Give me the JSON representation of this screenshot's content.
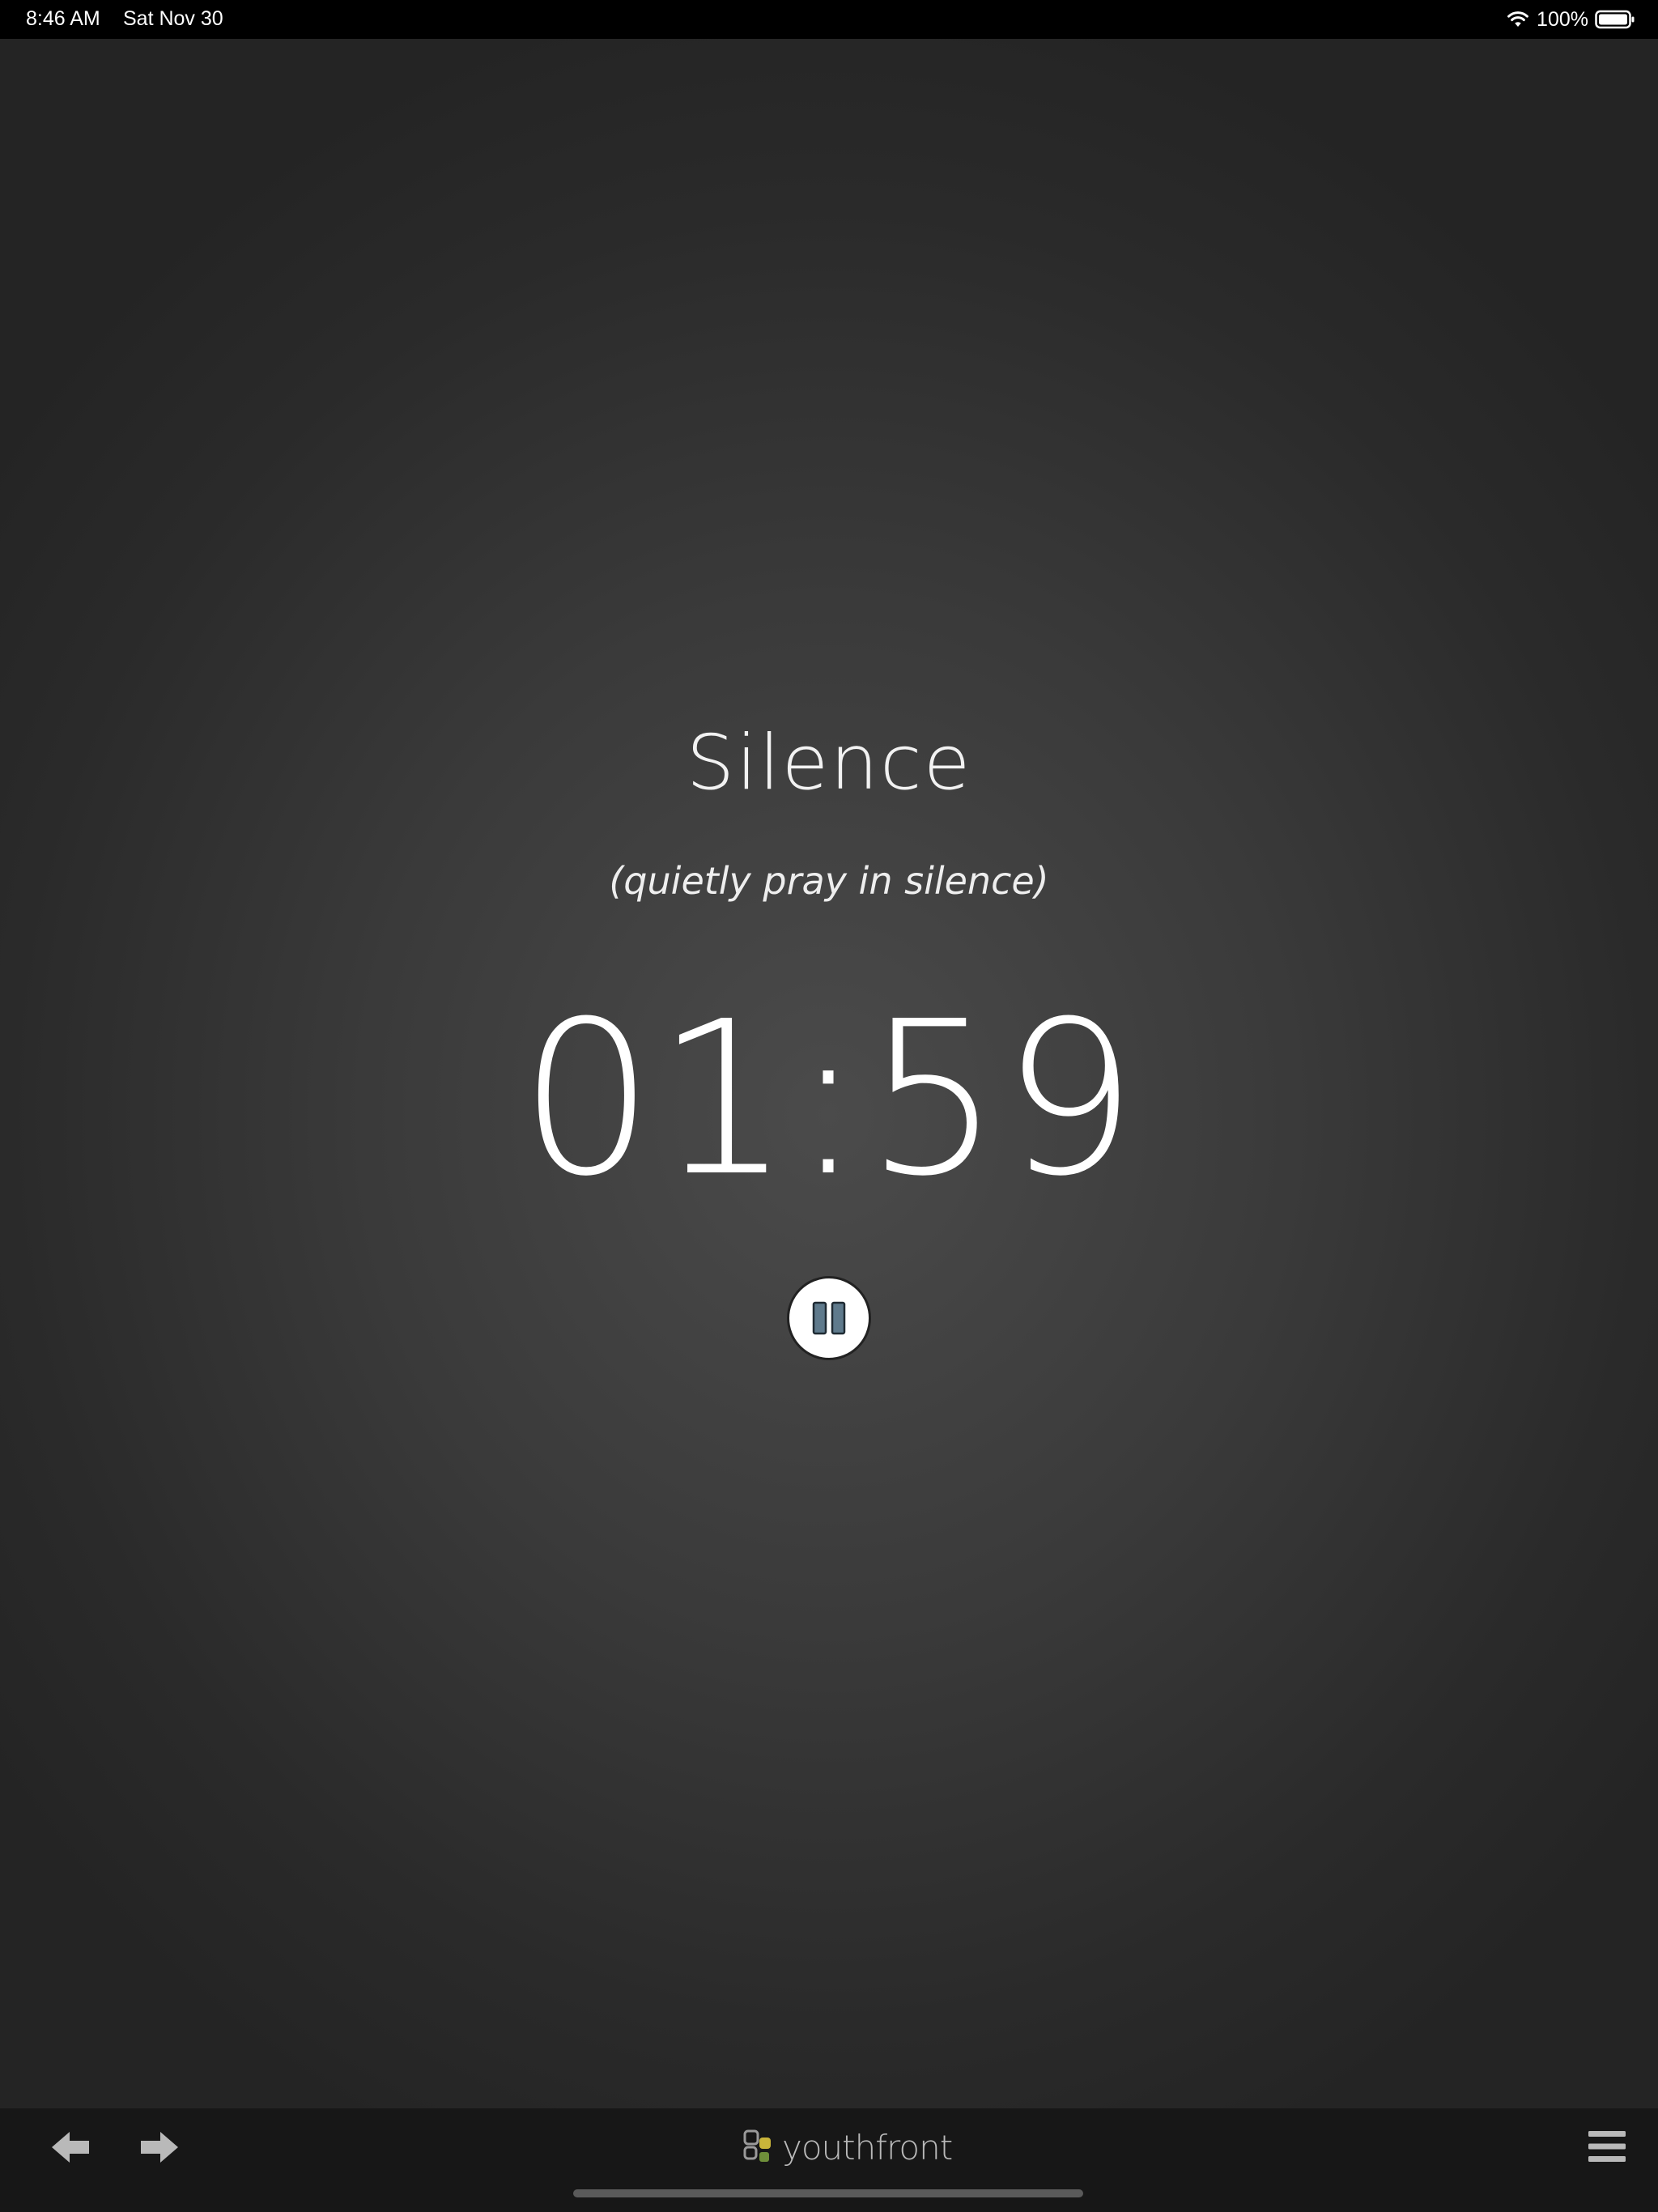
{
  "status_bar": {
    "time": "8:46 AM",
    "date": "Sat Nov 30",
    "battery": "100%",
    "icons": [
      "wifi-icon",
      "battery-icon"
    ]
  },
  "main": {
    "title": "Silence",
    "subtitle": "(quietly pray in silence)",
    "timer": "01:59",
    "pause_icon": "pause-icon"
  },
  "toolbar": {
    "back_icon": "arrow-left-icon",
    "forward_icon": "arrow-right-icon",
    "brand_name": "youthfront",
    "menu_icon": "hamburger-menu-icon"
  },
  "colors": {
    "background_center": "#4b4b4b",
    "background_edge": "#242424",
    "toolbar": "#171717",
    "status_bar": "#000000",
    "text": "#ffffff",
    "icon_gray": "#b9b9b9",
    "pause_bars": "#5f7a8c",
    "logo_yellow": "#c9b43a"
  }
}
